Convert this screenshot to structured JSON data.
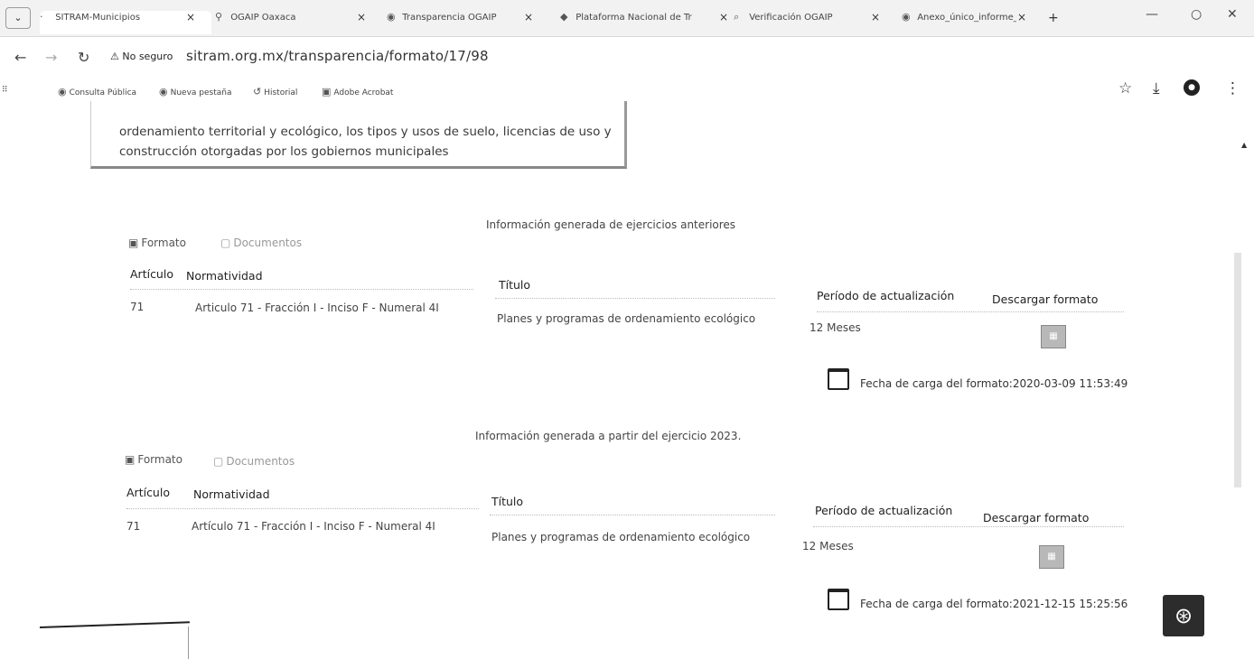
{
  "browser": {
    "tabs": [
      {
        "label": "SITRAM-Municipios",
        "icon": "sitram-icon",
        "active": true
      },
      {
        "label": "OGAIP Oaxaca",
        "icon": "pin-icon"
      },
      {
        "label": "Transparencia OGAIP",
        "icon": "globe-icon"
      },
      {
        "label": "Plataforma Nacional de Tr",
        "icon": "diamond-icon"
      },
      {
        "label": "Verificación OGAIP",
        "icon": "search-icon"
      },
      {
        "label": "Anexo_único_informe_li",
        "icon": "globe-icon"
      }
    ],
    "tab_close": "×",
    "new_tab": "+",
    "security": "No seguro",
    "url": "sitram.org.mx/transparencia/formato/17/98",
    "bookmarks": [
      {
        "label": "Consulta Pública",
        "icon": "globe-icon"
      },
      {
        "label": "Nueva pestaña",
        "icon": "globe-icon"
      },
      {
        "label": "Historial",
        "icon": "history-icon"
      },
      {
        "label": "Adobe Acrobat",
        "icon": "acrobat-icon"
      }
    ]
  },
  "description": {
    "lines": [
      "ordenamiento territorial y ecológico, los tipos y usos de suelo, licencias de uso y",
      "construcción otorgadas por los gobiernos municipales"
    ]
  },
  "sections": [
    {
      "title": "Información generada de ejercicios anteriores",
      "tab_format": "Formato",
      "tab_docs": "Documentos",
      "headers": {
        "articulo": "Artículo",
        "normatividad": "Normatividad",
        "titulo": "Título",
        "periodo": "Período de actualización",
        "descargar": "Descargar formato"
      },
      "row": {
        "articulo": "71",
        "normatividad": "Articulo 71 - Fracción I - Inciso F - Numeral 4I",
        "titulo": "Planes y programas de ordenamiento ecológico",
        "periodo": "12 Meses"
      },
      "fecha": "Fecha de carga del formato:2020-03-09 11:53:49"
    },
    {
      "title": "Información generada a partir del ejercicio 2023.",
      "tab_format": "Formato",
      "tab_docs": "Documentos",
      "headers": {
        "articulo": "Artículo",
        "normatividad": "Normatividad",
        "titulo": "Título",
        "periodo": "Período de actualización",
        "descargar": "Descargar formato"
      },
      "row": {
        "articulo": "71",
        "normatividad": "Artículo 71 - Fracción I - Inciso F - Numeral 4I",
        "titulo": "Planes y programas de ordenamiento ecológico",
        "periodo": "12 Meses"
      },
      "fecha": "Fecha de carga del formato:2021-12-15 15:25:56"
    }
  ]
}
